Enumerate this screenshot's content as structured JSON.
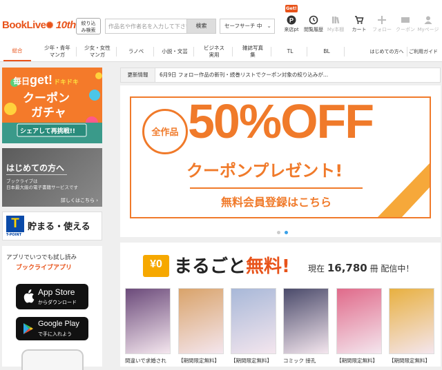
{
  "header": {
    "logo_text": "BookLive",
    "logo_badge": "10th",
    "narrow_search_label": "絞り込み検索",
    "search_placeholder": "作品名や作者名を入力して下さい",
    "search_button": "検索",
    "safe_search": "セーフサーチ 中",
    "get_badge": "Get!",
    "icons": [
      {
        "name": "visit-pt-icon",
        "label": "来店pt",
        "dim": false
      },
      {
        "name": "history-icon",
        "label": "閲覧履歴",
        "dim": false
      },
      {
        "name": "bookshelf-icon",
        "label": "My本棚",
        "dim": true
      },
      {
        "name": "cart-icon",
        "label": "カート",
        "dim": false
      },
      {
        "name": "follow-icon",
        "label": "フォロー",
        "dim": true
      },
      {
        "name": "coupon-icon",
        "label": "クーポン",
        "dim": true
      },
      {
        "name": "mypage-icon",
        "label": "Myページ",
        "dim": true
      }
    ]
  },
  "menu": {
    "items": [
      "総合",
      "少年・青年マンガ",
      "少女・女性マンガ",
      "ラノベ",
      "小説・文芸",
      "ビジネス実用",
      "雑誌写真集",
      "TL",
      "BL"
    ],
    "active": "総合",
    "right_links": [
      "はじめての方へ",
      "ご利用ガイド"
    ]
  },
  "sidebar": {
    "gacha": {
      "line1": "毎日",
      "get": "get!",
      "dokidoki": "ドキドキ",
      "line2": "クーポン",
      "line3": "ガチャ",
      "cta": "シェアして再挑戦!!"
    },
    "hajime": {
      "title": "はじめての方へ",
      "desc1": "ブックライブは",
      "desc2": "日本最大級の電子書籍サービスです",
      "link": "詳しくはこちら"
    },
    "tpoint": {
      "letter": "T",
      "sub": "T-POINT",
      "text": "貯まる・使える"
    },
    "app": {
      "line1": "アプリでいつでも試し読み",
      "line2": "ブックライブアプリ",
      "appstore_small": "App Store",
      "appstore_sub": "からダウンロード",
      "gplay_small": "Google Play",
      "gplay_sub": "で手に入れよう"
    }
  },
  "news": {
    "label": "更新情報",
    "text": "6月9日 フォロー作品の新刊・続巻リストでクーポン対象の絞り込みが..."
  },
  "hero": {
    "badge": "全作品",
    "big": "50%OFF",
    "sub": "クーポンプレゼント!",
    "cta": "無料会員登録はこちら"
  },
  "carousel": {
    "current": 2,
    "total": 2
  },
  "free_section": {
    "yen_badge": "¥0",
    "title_a": "まるごと",
    "title_b": "無料!",
    "stats_prefix": "現在",
    "count": "16,780",
    "stats_suffix": "冊 配信中！",
    "books": [
      {
        "title": "間違いで求婚され",
        "color": "#6b4a7a"
      },
      {
        "title": "【期間限定無料】",
        "color": "#d9a36a"
      },
      {
        "title": "【期間限定無料】",
        "color": "#a8b8d8"
      },
      {
        "title": "コミック 接孔",
        "color": "#4a4a6a"
      },
      {
        "title": "【期間限定無料】",
        "color": "#e06a8a"
      },
      {
        "title": "【期間限定無料】",
        "color": "#e8b040"
      }
    ]
  }
}
